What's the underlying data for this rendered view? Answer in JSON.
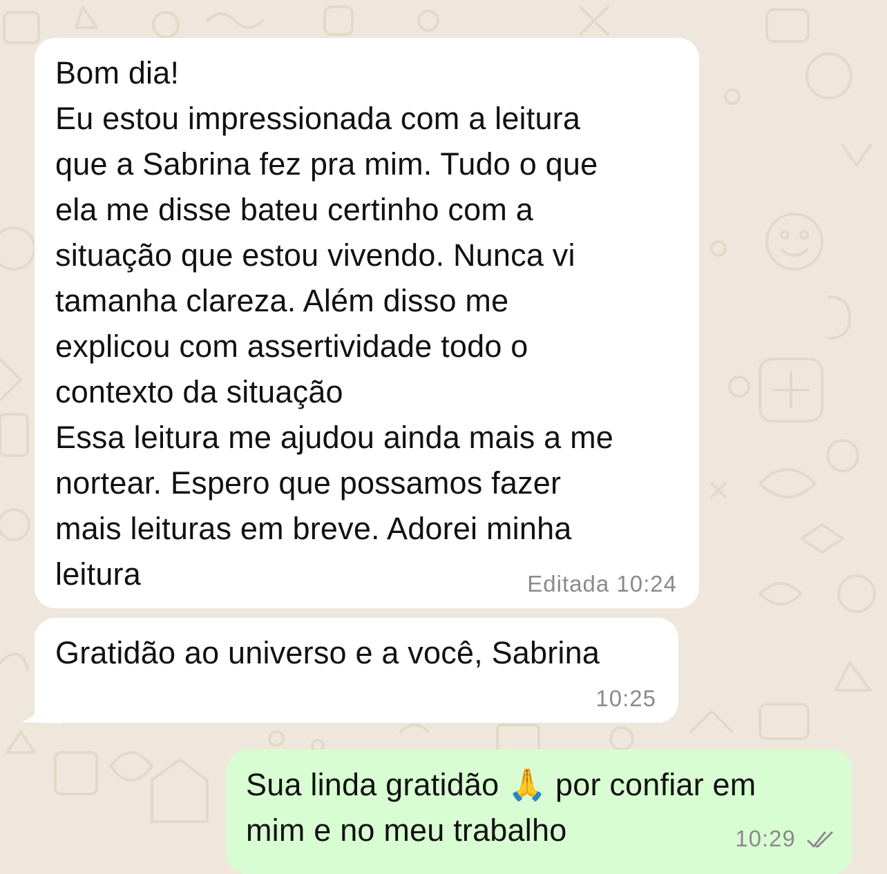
{
  "chat": {
    "messages": [
      {
        "direction": "incoming",
        "text": "Bom dia!\nEu estou impressionada com a leitura\nque a Sabrina fez pra mim. Tudo o que\nela me disse bateu certinho com a\nsituação que estou vivendo. Nunca vi\ntamanha clareza.  Além disso me\nexplicou com assertividade todo o\ncontexto da situação\nEssa leitura me ajudou ainda mais a me\nnortear.  Espero que possamos fazer\nmais leituras em breve. Adorei minha\nleitura",
        "edited_label": "Editada",
        "time": "10:24"
      },
      {
        "direction": "incoming",
        "text": "Gratidão ao universo e a você, Sabrina",
        "time": "10:25"
      },
      {
        "direction": "outgoing",
        "text": "Sua linda gratidão 🙏 por confiar em\nmim e no meu trabalho",
        "time": "10:29",
        "status_icon": "double-check-icon"
      }
    ]
  },
  "colors": {
    "wallpaper": "#efe7dc",
    "incoming_bubble": "#ffffff",
    "outgoing_bubble": "#d9fdd3",
    "timestamp": "#8a8a8a"
  }
}
